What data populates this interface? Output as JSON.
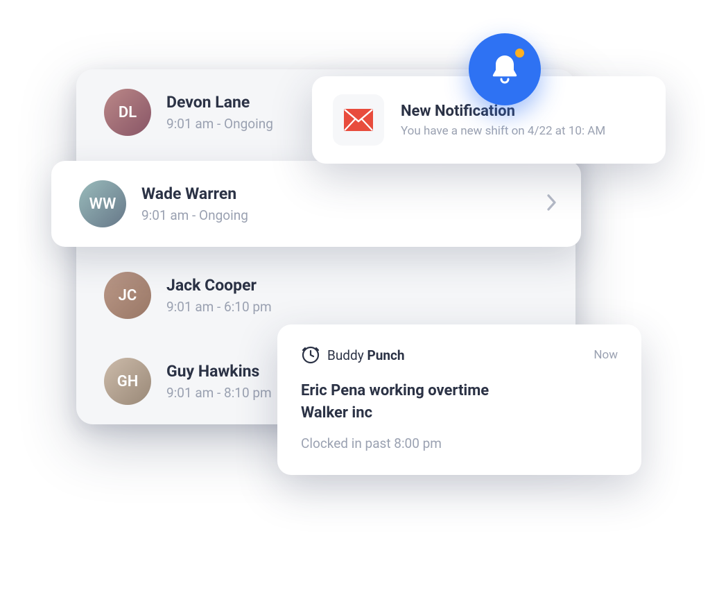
{
  "list": [
    {
      "name": "Devon Lane",
      "sub": "9:01 am - Ongoing",
      "initials": "DL"
    },
    {
      "name": "Wade Warren",
      "sub": "9:01 am - Ongoing",
      "initials": "WW"
    },
    {
      "name": "Jack Cooper",
      "sub": "9:01 am - 6:10 pm",
      "initials": "JC"
    },
    {
      "name": "Guy Hawkins",
      "sub": "9:01 am - 8:10 pm",
      "initials": "GH"
    }
  ],
  "notification": {
    "title": "New Notification",
    "body": "You have a new shift on 4/22 at 10: AM"
  },
  "overtime": {
    "brand_light": "Buddy",
    "brand_bold": "Punch",
    "time": "Now",
    "line1": "Eric Pena working  overtime",
    "line2": "Walker inc",
    "sub": "Clocked in past 8:00 pm"
  }
}
